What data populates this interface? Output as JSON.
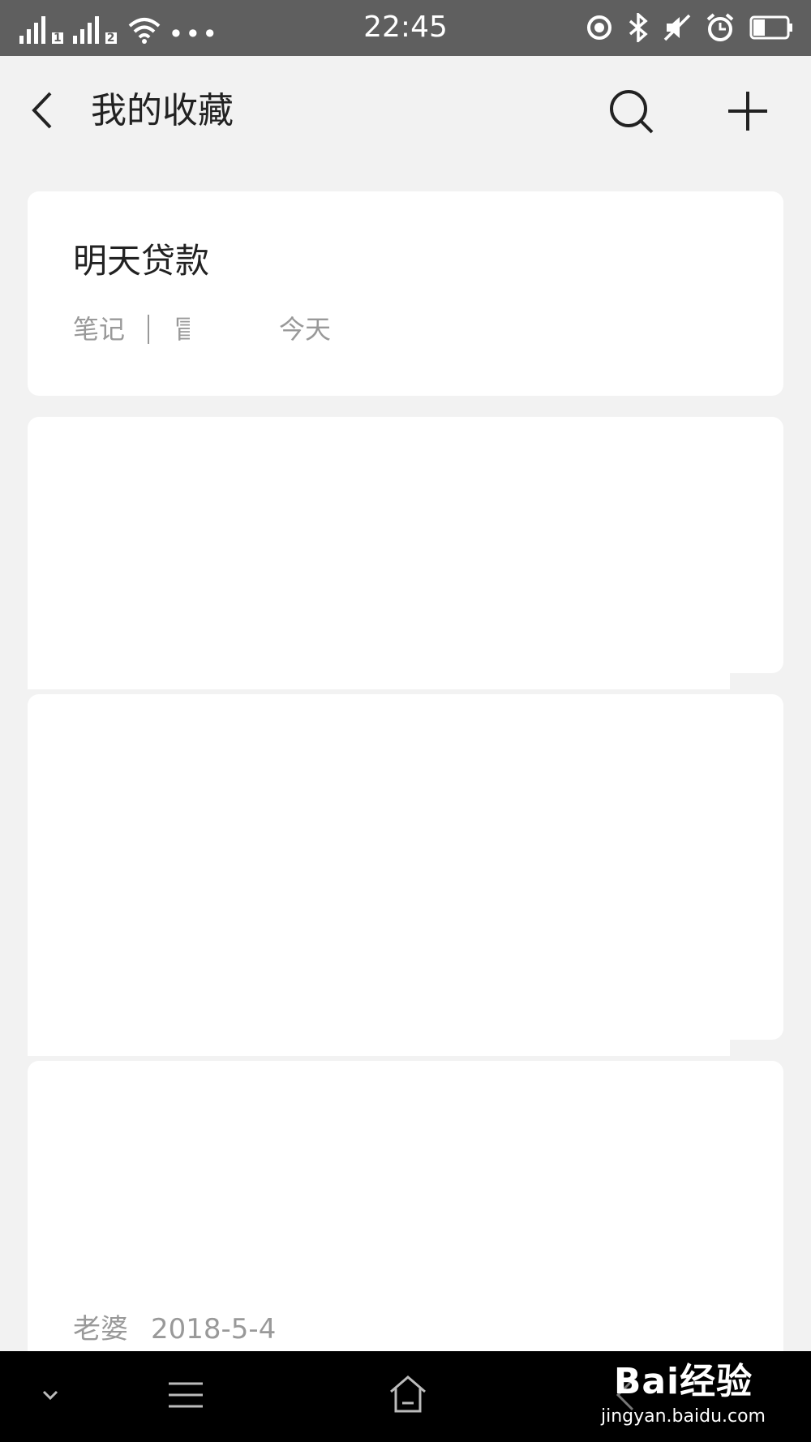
{
  "status_bar": {
    "time": "22:45",
    "sim1": "1",
    "sim2": "2",
    "more": "•••",
    "icons": [
      "signal-icon",
      "signal-icon",
      "wifi-icon",
      "location-icon",
      "bluetooth-icon",
      "mute-icon",
      "alarm-icon",
      "battery-icon"
    ],
    "battery_level": 0.35
  },
  "header": {
    "title": "我的收藏"
  },
  "items": [
    {
      "title": "明天贷款",
      "type": "笔记",
      "source_fragment": "冒",
      "date": "今天"
    },
    {
      "author": "老婆",
      "date": "2018-5-4"
    }
  ],
  "nav_bar": {
    "watermark_logo": "Bai经验",
    "watermark_url": "jingyan.baidu.com"
  },
  "colors": {
    "status_bar": "#5f5f5f",
    "page_bg": "#f2f2f2",
    "card_bg": "#ffffff",
    "nav_bar": "#000000",
    "muted_text": "#999999"
  }
}
